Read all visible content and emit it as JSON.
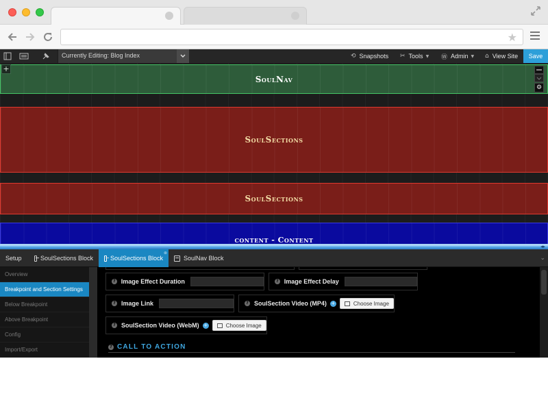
{
  "browser": {
    "url": "",
    "icons": {
      "back": "back-arrow-icon",
      "forward": "forward-arrow-icon",
      "reload": "reload-icon",
      "bookmark": "star-icon",
      "menu": "hamburger-icon",
      "fullscreen": "expand-icon"
    }
  },
  "editor": {
    "currently_editing": "Currently Editing: Blog Index",
    "toolbar": {
      "snapshots": "Snapshots",
      "tools": "Tools",
      "admin": "Admin",
      "view_site": "View Site",
      "save": "Save"
    }
  },
  "canvas": {
    "blocks": [
      {
        "name": "SoulNav",
        "color": "#2e5c3a"
      },
      {
        "name": "SoulSections",
        "color": "#7a1e19"
      },
      {
        "name": "SoulSections",
        "color": "#7a1e19"
      },
      {
        "name": "content - Content",
        "color": "#0a0a9e"
      }
    ],
    "add_symbol": "+"
  },
  "panel": {
    "tabs": [
      {
        "label": "Setup",
        "active": false
      },
      {
        "label": "SoulSections Block",
        "active": false
      },
      {
        "label": "SoulSections Block",
        "active": true
      },
      {
        "label": "SoulNav Block",
        "active": false
      }
    ],
    "sidebar": [
      {
        "label": "Overview",
        "active": false
      },
      {
        "label": "Breakpoint and Section Settings",
        "active": true
      },
      {
        "label": "Below Breakpoint",
        "active": false
      },
      {
        "label": "Above Breakpoint",
        "active": false
      },
      {
        "label": "Config",
        "active": false
      },
      {
        "label": "Import/Export",
        "active": false
      }
    ],
    "fields": {
      "image_effect_duration": {
        "label": "Image Effect Duration",
        "value": ""
      },
      "image_effect_delay": {
        "label": "Image Effect Delay",
        "value": ""
      },
      "image_link": {
        "label": "Image Link",
        "value": ""
      },
      "video_mp4": {
        "label": "SoulSection Video (MP4)",
        "button": "Choose Image"
      },
      "video_webm": {
        "label": "SoulSection Video (WebM)",
        "button": "Choose Image"
      }
    },
    "section_heading": "CALL TO ACTION"
  },
  "colors": {
    "accent": "#1a87c2",
    "save": "#2d9fd9",
    "nav_border": "#45c466",
    "section_border": "#e0392f",
    "content_border": "#3a3ae0"
  }
}
